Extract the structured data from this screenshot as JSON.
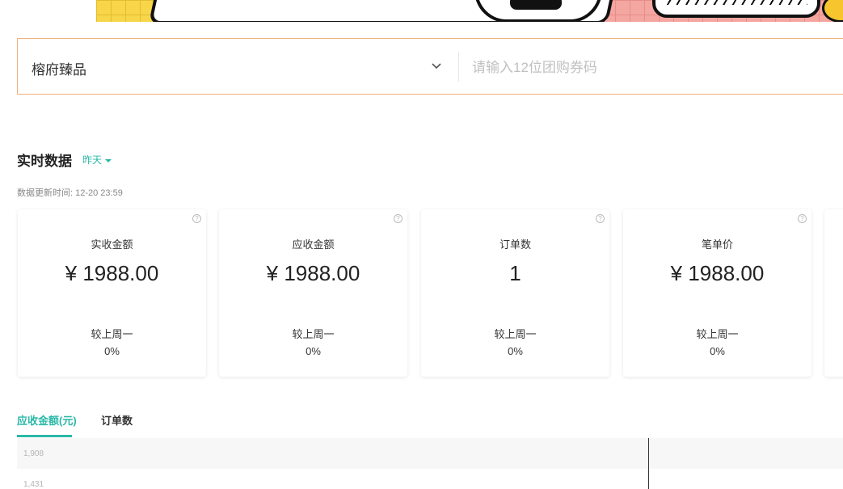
{
  "search": {
    "store_name": "榕府臻品",
    "coupon_placeholder": "请输入12位团购券码"
  },
  "realtime": {
    "title": "实时数据",
    "period": "昨天",
    "update_time": "数据更新时间: 12-20 23:59"
  },
  "cards": [
    {
      "label": "实收金额",
      "value": "¥ 1988.00",
      "compare_label": "较上周一",
      "compare_value": "0%"
    },
    {
      "label": "应收金额",
      "value": "¥ 1988.00",
      "compare_label": "较上周一",
      "compare_value": "0%"
    },
    {
      "label": "订单数",
      "value": "1",
      "compare_label": "较上周一",
      "compare_value": "0%"
    },
    {
      "label": "笔单价",
      "value": "¥ 1988.00",
      "compare_label": "较上周一",
      "compare_value": "0%"
    }
  ],
  "chart_tabs": [
    {
      "label": "应收金额(元)",
      "active": true
    },
    {
      "label": "订单数",
      "active": false
    }
  ],
  "chart_data": {
    "type": "line",
    "y_ticks": [
      "1,908",
      "1,431"
    ],
    "series": []
  },
  "colors": {
    "accent": "#2bb8a8",
    "search_border": "#f3b07a"
  }
}
